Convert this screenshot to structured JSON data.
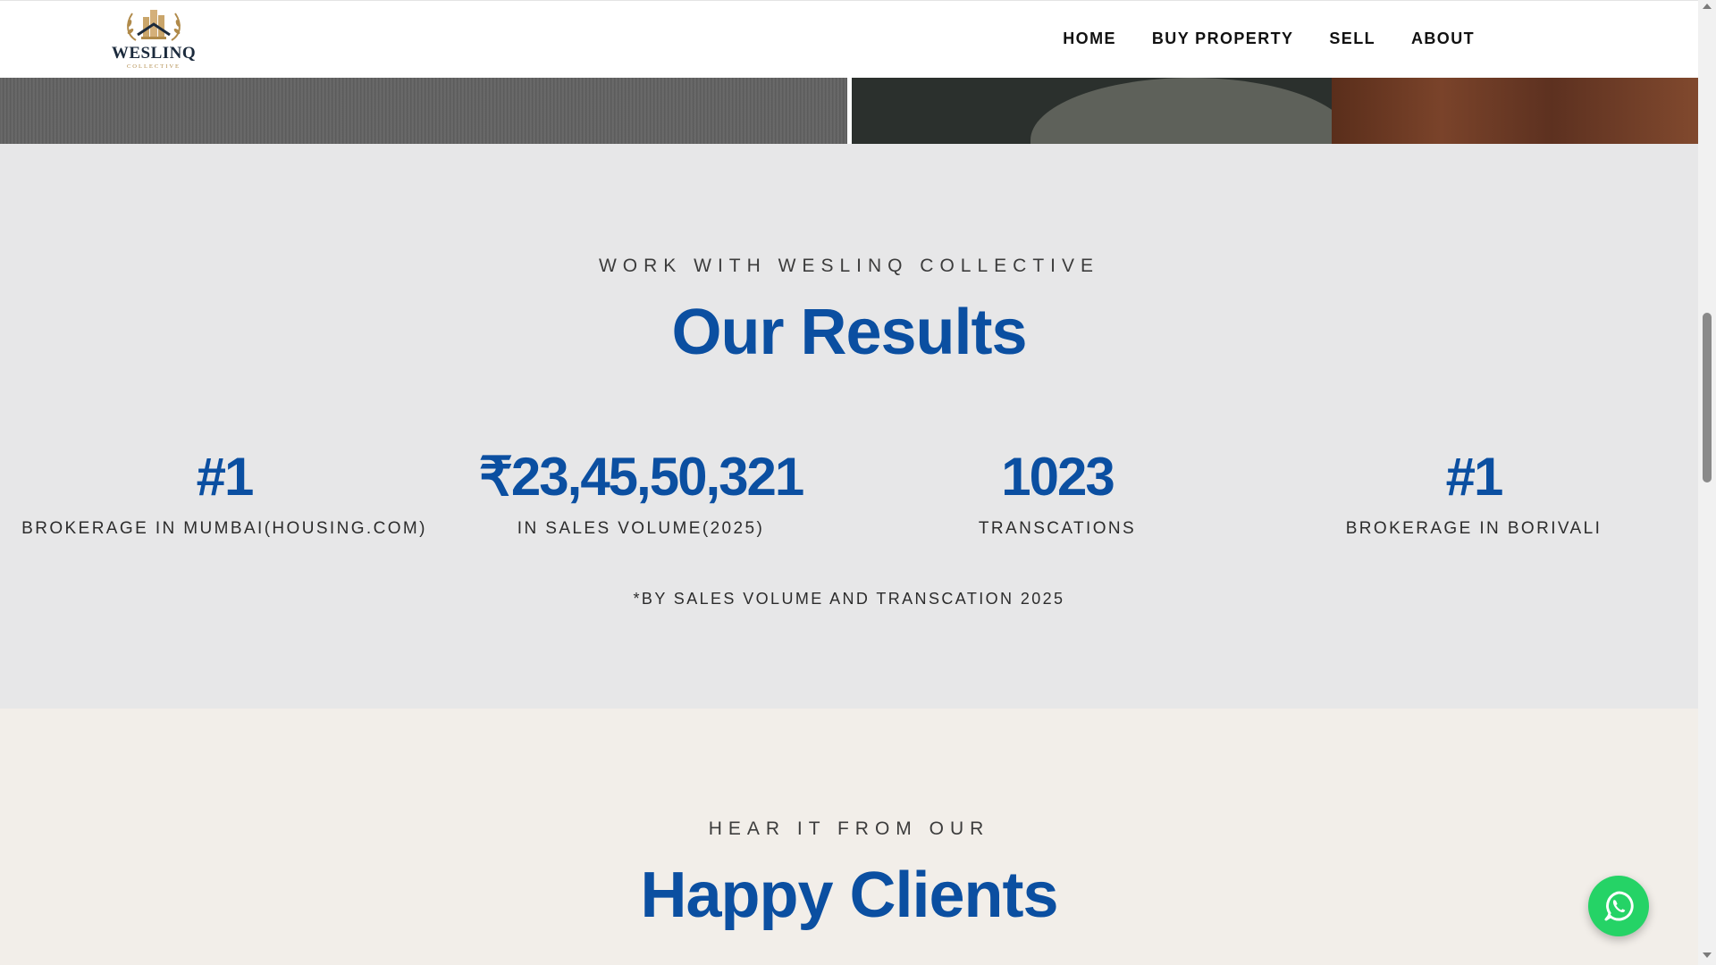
{
  "brand": {
    "name": "WESLINQ",
    "tagline": "COLLECTIVE",
    "gold": "#b08a4a"
  },
  "nav": {
    "items": [
      "HOME",
      "BUY PROPERTY",
      "SELL",
      "ABOUT"
    ]
  },
  "results": {
    "eyebrow": "WORK WITH WESLINQ COLLECTIVE",
    "title": "Our Results",
    "accent": "#0b4fa1",
    "stats": [
      {
        "value": "#1",
        "label": "BROKERAGE IN MUMBAI(HOUSING.COM)"
      },
      {
        "value": "₹23,45,50,321",
        "label": "IN SALES VOLUME(2025)"
      },
      {
        "value": "1023",
        "label": "TRANSCATIONS"
      },
      {
        "value": "#1",
        "label": "BROKERAGE IN BORIVALI"
      }
    ],
    "footnote": "*BY SALES VOLUME AND TRANSCATION 2025"
  },
  "clients": {
    "eyebrow": "HEAR IT FROM OUR",
    "title": "Happy Clients"
  },
  "floating": {
    "whatsapp_icon": "whatsapp-icon",
    "color": "#25d366"
  }
}
